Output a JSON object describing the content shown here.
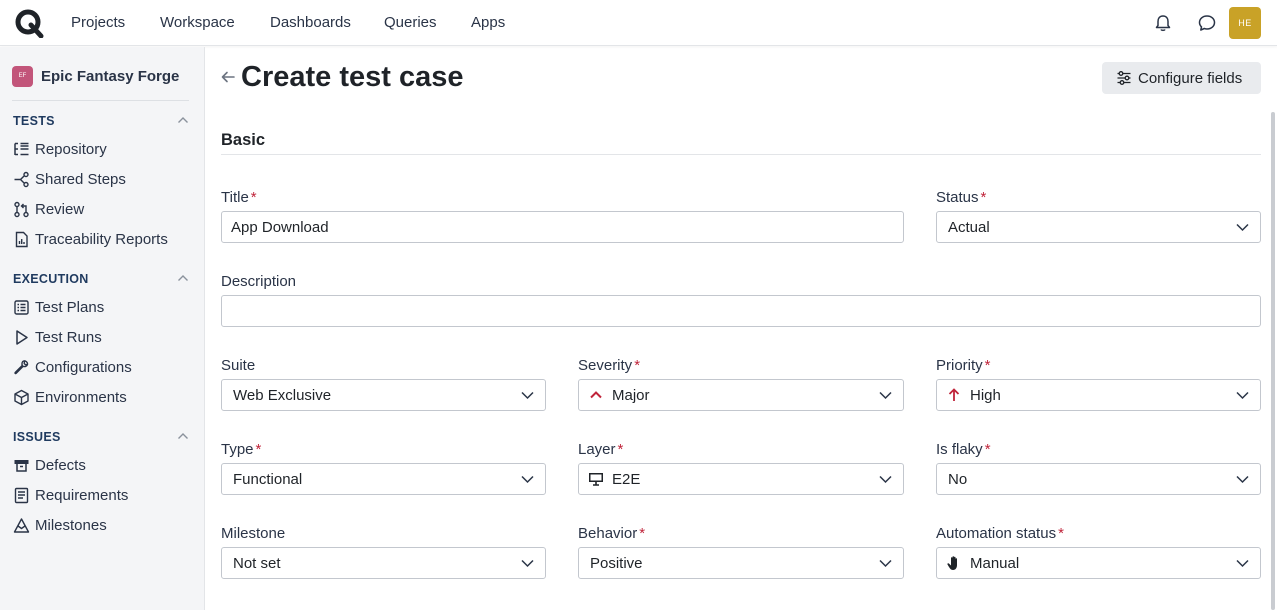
{
  "topnav": {
    "items": [
      "Projects",
      "Workspace",
      "Dashboards",
      "Queries",
      "Apps"
    ],
    "avatar_initials": "HE",
    "avatar_color": "#c9a227"
  },
  "sidebar": {
    "project": {
      "badge": "EF",
      "name": "Epic Fantasy Forge",
      "color": "#c2557a"
    },
    "sections": [
      {
        "title": "TESTS",
        "items": [
          {
            "icon": "repository-icon",
            "label": "Repository"
          },
          {
            "icon": "shared-steps-icon",
            "label": "Shared Steps"
          },
          {
            "icon": "review-icon",
            "label": "Review"
          },
          {
            "icon": "traceability-reports-icon",
            "label": "Traceability Reports"
          }
        ]
      },
      {
        "title": "EXECUTION",
        "items": [
          {
            "icon": "test-plans-icon",
            "label": "Test Plans"
          },
          {
            "icon": "play-icon",
            "label": "Test Runs"
          },
          {
            "icon": "wrench-icon",
            "label": "Configurations"
          },
          {
            "icon": "cube-icon",
            "label": "Environments"
          }
        ]
      },
      {
        "title": "ISSUES",
        "items": [
          {
            "icon": "defects-icon",
            "label": "Defects"
          },
          {
            "icon": "requirements-icon",
            "label": "Requirements"
          },
          {
            "icon": "milestone-icon",
            "label": "Milestones"
          }
        ]
      }
    ]
  },
  "main": {
    "title": "Create test case",
    "configure_button": "Configure fields",
    "section": "Basic",
    "required_mark": "*",
    "fields": {
      "title": {
        "label": "Title",
        "value": "App Download"
      },
      "status": {
        "label": "Status",
        "value": "Actual"
      },
      "description": {
        "label": "Description",
        "value": ""
      },
      "suite": {
        "label": "Suite",
        "value": "Web Exclusive"
      },
      "severity": {
        "label": "Severity",
        "value": "Major",
        "icon": "chevron-up-icon"
      },
      "priority": {
        "label": "Priority",
        "value": "High",
        "icon": "arrow-up-icon"
      },
      "type": {
        "label": "Type",
        "value": "Functional"
      },
      "layer": {
        "label": "Layer",
        "value": "E2E",
        "icon": "monitor-icon"
      },
      "is_flaky": {
        "label": "Is flaky",
        "value": "No"
      },
      "milestone": {
        "label": "Milestone",
        "value": "Not set"
      },
      "behavior": {
        "label": "Behavior",
        "value": "Positive"
      },
      "automation_status": {
        "label": "Automation status",
        "value": "Manual",
        "icon": "hand-icon"
      }
    },
    "accent_red": "#c0243a"
  }
}
